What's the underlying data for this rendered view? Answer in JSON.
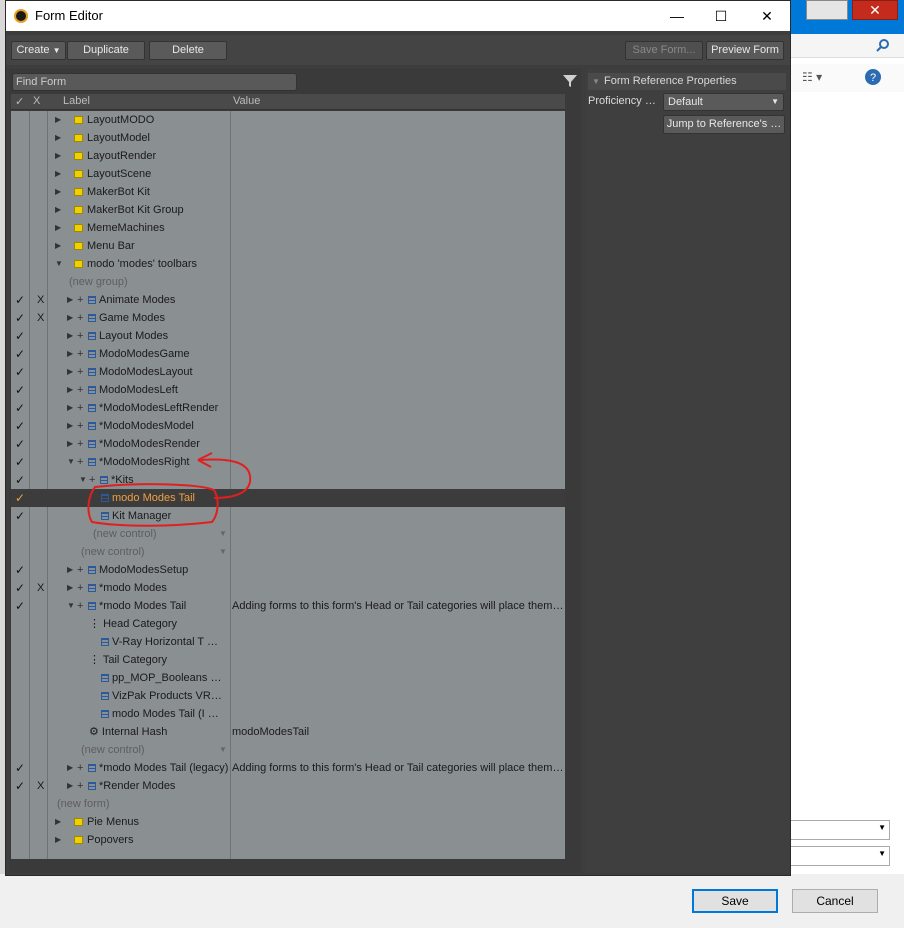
{
  "window": {
    "title": "Form Editor",
    "controls": {
      "minimize": "—",
      "maximize": "☐",
      "close": "✕"
    }
  },
  "toolbar": {
    "create": "Create",
    "duplicate": "Duplicate",
    "delete": "Delete",
    "save_form": "Save Form...",
    "preview_form": "Preview Form"
  },
  "find": {
    "placeholder": "Find Form"
  },
  "columns": {
    "check": "✓",
    "x": "X",
    "label": "Label",
    "value": "Value"
  },
  "tree": [
    {
      "label": "LayoutMODO",
      "kind": "folder",
      "depth": 0,
      "arrow": "▶"
    },
    {
      "label": "LayoutModel",
      "kind": "folder",
      "depth": 0,
      "arrow": "▶"
    },
    {
      "label": "LayoutRender",
      "kind": "folder",
      "depth": 0,
      "arrow": "▶"
    },
    {
      "label": "LayoutScene",
      "kind": "folder",
      "depth": 0,
      "arrow": "▶"
    },
    {
      "label": "MakerBot Kit",
      "kind": "folder",
      "depth": 0,
      "arrow": "▶"
    },
    {
      "label": "MakerBot Kit Group",
      "kind": "folder",
      "depth": 0,
      "arrow": "▶"
    },
    {
      "label": "MemeMachines",
      "kind": "folder",
      "depth": 0,
      "arrow": "▶"
    },
    {
      "label": "Menu Bar",
      "kind": "folder",
      "depth": 0,
      "arrow": "▶"
    },
    {
      "label": "modo 'modes' toolbars",
      "kind": "folder",
      "depth": 0,
      "arrow": "▼"
    },
    {
      "label": "(new group)",
      "kind": "new",
      "depth": 1
    },
    {
      "label": "Animate Modes",
      "kind": "form",
      "depth": 1,
      "check": "✓",
      "x": "X",
      "arrow": "▶",
      "plus": "+"
    },
    {
      "label": "Game Modes",
      "kind": "form",
      "depth": 1,
      "check": "✓",
      "x": "X",
      "arrow": "▶",
      "plus": "+"
    },
    {
      "label": "Layout Modes",
      "kind": "form",
      "depth": 1,
      "check": "✓",
      "arrow": "▶",
      "plus": "+"
    },
    {
      "label": "ModoModesGame",
      "kind": "form",
      "depth": 1,
      "check": "✓",
      "arrow": "▶",
      "plus": "+"
    },
    {
      "label": "ModoModesLayout",
      "kind": "form",
      "depth": 1,
      "check": "✓",
      "arrow": "▶",
      "plus": "+"
    },
    {
      "label": "ModoModesLeft",
      "kind": "form",
      "depth": 1,
      "check": "✓",
      "arrow": "▶",
      "plus": "+"
    },
    {
      "label": "*ModoModesLeftRender",
      "kind": "form",
      "depth": 1,
      "check": "✓",
      "arrow": "▶",
      "plus": "+"
    },
    {
      "label": "*ModoModesModel",
      "kind": "form",
      "depth": 1,
      "check": "✓",
      "arrow": "▶",
      "plus": "+"
    },
    {
      "label": "*ModoModesRender",
      "kind": "form",
      "depth": 1,
      "check": "✓",
      "arrow": "▶",
      "plus": "+"
    },
    {
      "label": "*ModoModesRight",
      "kind": "form",
      "depth": 1,
      "check": "✓",
      "arrow": "▼",
      "plus": "+"
    },
    {
      "label": "*Kits",
      "kind": "form",
      "depth": 2,
      "check": "✓",
      "arrow": "▼",
      "plus": "+"
    },
    {
      "label": "modo Modes Tail",
      "kind": "form",
      "depth": 3,
      "check": "✓",
      "selected": true
    },
    {
      "label": "Kit Manager",
      "kind": "form",
      "depth": 3,
      "check": "✓"
    },
    {
      "label": "(new control)",
      "kind": "new",
      "depth": 3,
      "dd": "▼"
    },
    {
      "label": "(new control)",
      "kind": "new",
      "depth": 2,
      "dd": "▼"
    },
    {
      "label": "ModoModesSetup",
      "kind": "form",
      "depth": 1,
      "check": "✓",
      "arrow": "▶",
      "plus": "+"
    },
    {
      "label": "*modo Modes",
      "kind": "form",
      "depth": 1,
      "check": "✓",
      "x": "X",
      "arrow": "▶",
      "plus": "+"
    },
    {
      "label": "*modo Modes Tail",
      "kind": "form",
      "depth": 1,
      "check": "✓",
      "arrow": "▼",
      "plus": "+",
      "value": "Adding forms to this form's Head or Tail categories will place them …"
    },
    {
      "label": "Head Category",
      "kind": "cat",
      "depth": 2
    },
    {
      "label": "V-Ray Horizontal T …",
      "kind": "form",
      "depth": 3
    },
    {
      "label": "Tail Category",
      "kind": "cat",
      "depth": 2
    },
    {
      "label": "pp_MOP_Booleans …",
      "kind": "form",
      "depth": 3
    },
    {
      "label": "VizPak Products VR…",
      "kind": "form",
      "depth": 3
    },
    {
      "label": "modo Modes Tail (I …",
      "kind": "form",
      "depth": 3
    },
    {
      "label": "Internal Hash",
      "kind": "hash",
      "depth": 2,
      "value": "modoModesTail"
    },
    {
      "label": "(new control)",
      "kind": "new",
      "depth": 2,
      "dd": "▼"
    },
    {
      "label": "*modo Modes Tail (legacy)",
      "kind": "form",
      "depth": 1,
      "check": "✓",
      "arrow": "▶",
      "plus": "+",
      "value": "Adding forms to this form's Head or Tail categories will place them …"
    },
    {
      "label": "*Render Modes",
      "kind": "form",
      "depth": 1,
      "check": "✓",
      "x": "X",
      "arrow": "▶",
      "plus": "+"
    },
    {
      "label": "(new form)",
      "kind": "new",
      "depth": 0
    },
    {
      "label": "Pie Menus",
      "kind": "folder",
      "depth": 0,
      "arrow": "▶"
    },
    {
      "label": "Popovers",
      "kind": "folder",
      "depth": 0,
      "arrow": "▶"
    }
  ],
  "properties": {
    "header": "Form Reference Properties",
    "proficiency_label": "Proficiency …",
    "proficiency_value": "Default",
    "jump_button": "Jump to Reference's …"
  },
  "dialog": {
    "save": "Save",
    "cancel": "Cancel"
  },
  "colors": {
    "selection_text": "#f0a040",
    "annotation": "#e02020",
    "folder": "#f0d000"
  }
}
